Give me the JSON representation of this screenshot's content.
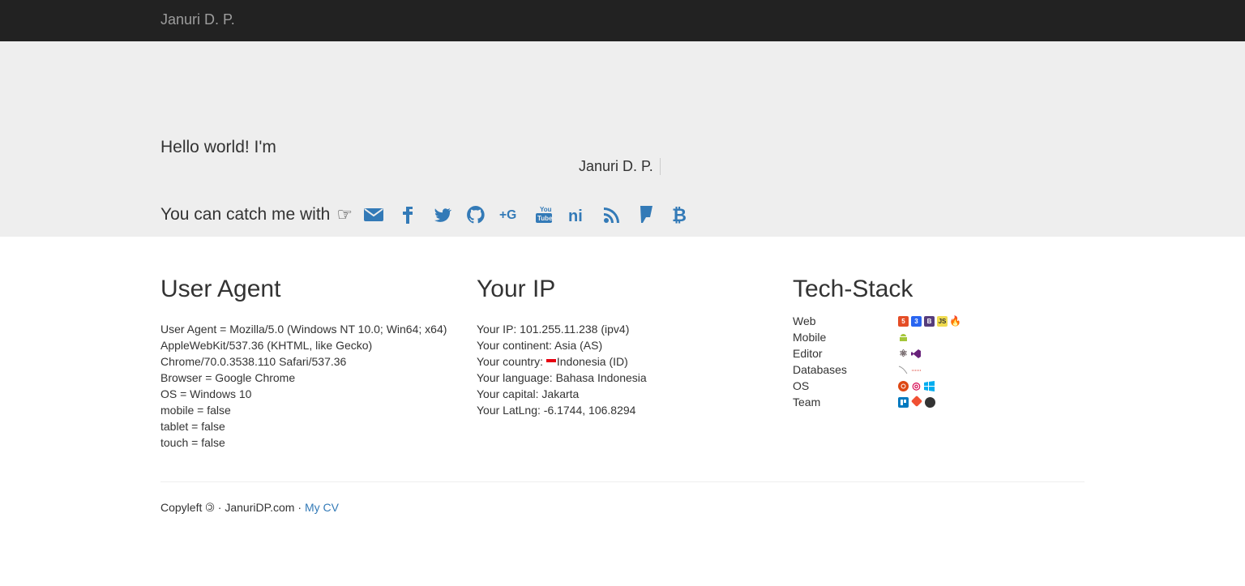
{
  "navbar": {
    "brand": "Januri D. P."
  },
  "hero": {
    "hello": "Hello world! I'm",
    "typed_name": "Januri D. P.",
    "catch_text": "You can catch me with",
    "pointer_glyph": "☞",
    "social_icons": [
      "email-icon",
      "facebook-icon",
      "twitter-icon",
      "github-icon",
      "google-plus-icon",
      "youtube-icon",
      "slideshare-icon",
      "rss-icon",
      "foursquare-icon",
      "bitcoin-icon"
    ]
  },
  "user_agent": {
    "title": "User Agent",
    "lines": [
      "User Agent = Mozilla/5.0 (Windows NT 10.0; Win64; x64)",
      "AppleWebKit/537.36 (KHTML, like Gecko)",
      "Chrome/70.0.3538.110 Safari/537.36",
      "Browser = Google Chrome",
      "OS = Windows 10",
      "mobile = false",
      "tablet = false",
      "touch = false"
    ]
  },
  "your_ip": {
    "title": "Your IP",
    "ip": "Your IP: 101.255.11.238 (ipv4)",
    "continent": "Your continent: Asia (AS)",
    "country_prefix": "Your country: ",
    "country": "Indonesia (ID)",
    "language": "Your language: Bahasa Indonesia",
    "capital": "Your capital: Jakarta",
    "latlng": "Your LatLng: -6.1744, 106.8294"
  },
  "tech_stack": {
    "title": "Tech-Stack",
    "rows": [
      {
        "label": "Web",
        "icons": [
          "html5-icon",
          "css3-icon",
          "bootstrap-icon",
          "javascript-icon",
          "codeigniter-icon"
        ]
      },
      {
        "label": "Mobile",
        "icons": [
          "android-icon"
        ]
      },
      {
        "label": "Editor",
        "icons": [
          "atom-icon",
          "visual-studio-icon"
        ]
      },
      {
        "label": "Databases",
        "icons": [
          "mysql-icon",
          "redis-icon"
        ]
      },
      {
        "label": "OS",
        "icons": [
          "ubuntu-icon",
          "debian-icon",
          "windows-icon"
        ]
      },
      {
        "label": "Team",
        "icons": [
          "trello-icon",
          "git-icon",
          "github-icon"
        ]
      }
    ]
  },
  "footer": {
    "copyleft": "Copyleft",
    "copyleft_glyph": "🄯",
    "separator": "·",
    "site": "JanuriDP.com",
    "cv_link": "My CV"
  }
}
